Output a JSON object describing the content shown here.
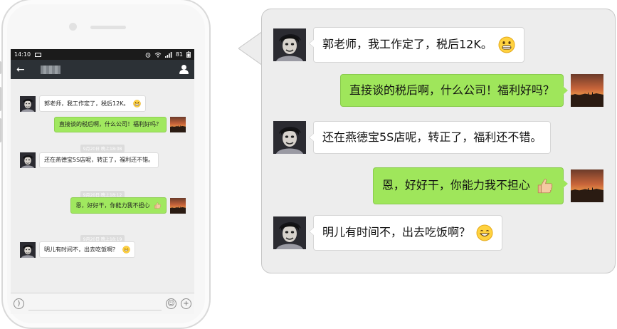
{
  "phone": {
    "status_bar": {
      "time": "14:10",
      "battery": "81"
    },
    "nav": {
      "back_icon": "back-arrow-icon",
      "profile_icon": "person-icon"
    },
    "messages": [
      {
        "side": "left",
        "text": "郭老师，我工作定了，税后12K。",
        "emoji": "grin-emoji"
      },
      {
        "side": "right",
        "text": "直接谈的税后啊，什么公司！福利好吗？"
      },
      {
        "side": "stamp",
        "text": "9月20日 晚上18:08"
      },
      {
        "side": "left",
        "text": "还在燕德宝5S店呢，转正了，福利还不错。"
      },
      {
        "side": "stamp",
        "text": "9月20日 晚上18:12"
      },
      {
        "side": "right",
        "text": "恩，好好干，你能力我不担心",
        "emoji": "thumbs-up-emoji"
      },
      {
        "side": "stamp",
        "text": "9月20日 晚上18:19"
      },
      {
        "side": "left",
        "text": "明儿有时间不，出去吃饭啊？",
        "emoji": "smile-emoji"
      }
    ],
    "input_bar": {
      "voice_icon": "voice-icon",
      "emoji_icon": "emoji-icon",
      "plus_icon": "plus-icon"
    }
  },
  "zoom": {
    "messages": [
      {
        "side": "left",
        "text": "郭老师，我工作定了，税后12K。",
        "emoji": "grin-emoji"
      },
      {
        "side": "right",
        "text": "直接谈的税后啊，什么公司！福利好吗？"
      },
      {
        "side": "left",
        "text": "还在燕德宝5S店呢，转正了，福利还不错。"
      },
      {
        "side": "right",
        "text": "恩，好好干，你能力我不担心",
        "emoji": "thumbs-up-emoji"
      },
      {
        "side": "left",
        "text": "明儿有时间不，出去吃饭啊？",
        "emoji": "smile-emoji"
      }
    ]
  },
  "colors": {
    "green_bubble": "#9fe65b",
    "nav_bar": "#2c3136",
    "status_bar": "#1b1b1b",
    "panel_bg": "#ededed"
  }
}
